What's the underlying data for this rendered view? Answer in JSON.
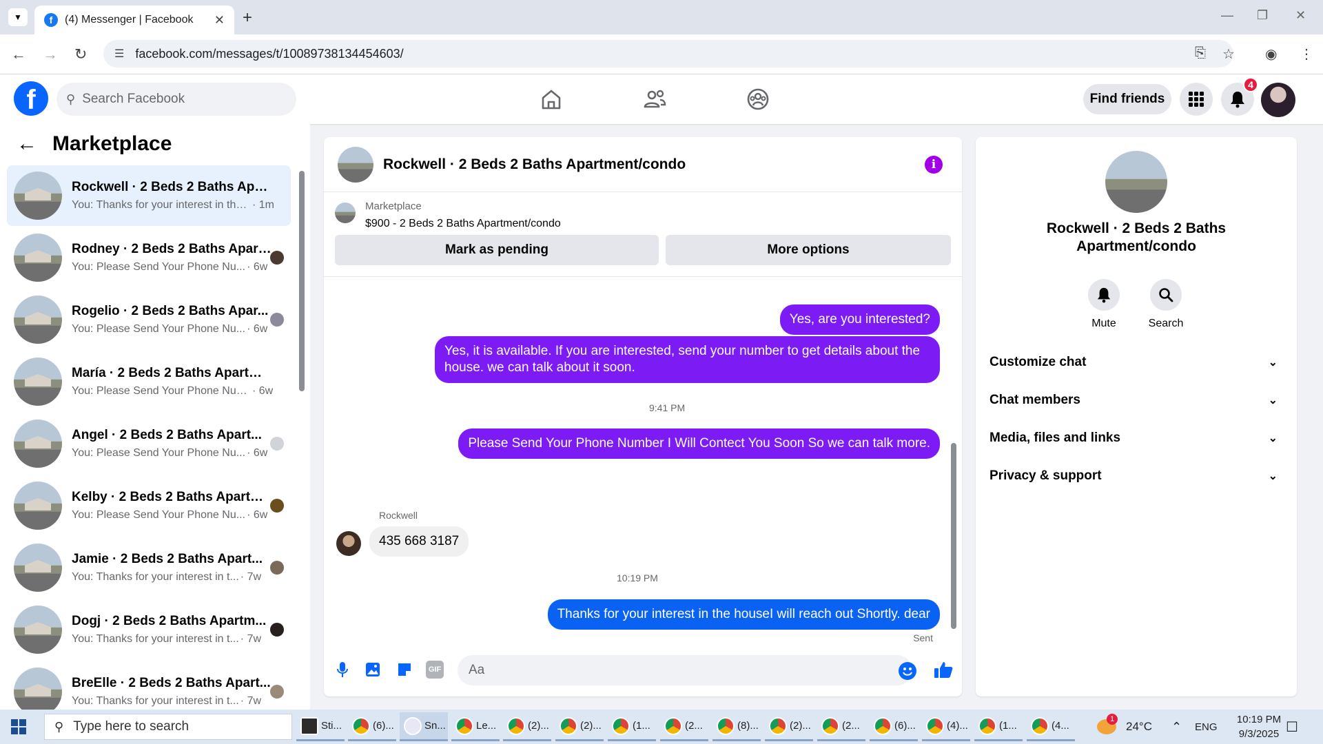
{
  "browser": {
    "tab_title": "(4) Messenger | Facebook",
    "url": "facebook.com/messages/t/10089738134454603/"
  },
  "fb": {
    "search_placeholder": "Search Facebook",
    "find_friends": "Find friends",
    "notification_count": "4"
  },
  "left": {
    "title": "Marketplace",
    "conversations": [
      {
        "name": "Rockwell · 2 Beds 2 Baths Apart...",
        "snippet": "You: Thanks for your interest in the...",
        "time": "· 1m"
      },
      {
        "name": "Rodney · 2 Beds 2 Baths Apart...",
        "snippet": "You: Please Send Your Phone Nu...",
        "time": "· 6w"
      },
      {
        "name": "Rogelio · 2 Beds 2 Baths Apar...",
        "snippet": "You: Please Send Your Phone Nu...",
        "time": "· 6w"
      },
      {
        "name": "María · 2 Beds 2 Baths Apartme...",
        "snippet": "You: Please Send Your Phone Num...",
        "time": "· 6w"
      },
      {
        "name": "Angel · 2 Beds 2 Baths Apart...",
        "snippet": "You: Please Send Your Phone Nu...",
        "time": "· 6w"
      },
      {
        "name": "Kelby · 2 Beds 2 Baths Apartm...",
        "snippet": "You: Please Send Your Phone Nu...",
        "time": "· 6w"
      },
      {
        "name": "Jamie · 2 Beds 2 Baths Apart...",
        "snippet": "You: Thanks for your interest in t...",
        "time": "· 7w"
      },
      {
        "name": "Dogj · 2 Beds 2 Baths Apartm...",
        "snippet": "You: Thanks for your interest in t...",
        "time": "· 7w"
      },
      {
        "name": "BreElle · 2 Beds 2 Baths Apart...",
        "snippet": "You: Thanks for your interest in t...",
        "time": "· 7w"
      }
    ]
  },
  "chat": {
    "title": "Rockwell · 2 Beds 2 Baths Apartment/condo",
    "marketplace_label": "Marketplace",
    "listing": "$900 - 2 Beds 2 Baths Apartment/condo",
    "mark_pending": "Mark as pending",
    "more_options": "More options",
    "messages": {
      "m1": "Yes, are you interested?",
      "m2": "Yes, it is available. If you are interested, send your number to get details about the house. we can talk about it soon.",
      "ts1": "9:41 PM",
      "m3": "Please Send Your Phone Number I Will Contect You Soon So we can talk more.",
      "sender": "Rockwell",
      "m4": "435 668 3187",
      "ts2": "10:19 PM",
      "m5": "Thanks for your interest in the houseI will reach out Shortly. dear",
      "status": "Sent"
    },
    "composer_placeholder": "Aa"
  },
  "right": {
    "name": "Rockwell · 2 Beds 2 Baths Apartment/condo",
    "mute": "Mute",
    "search": "Search",
    "sections": [
      "Customize chat",
      "Chat members",
      "Media, files and links",
      "Privacy & support"
    ]
  },
  "taskbar": {
    "search_placeholder": "Type here to search",
    "apps": [
      "Sti...",
      "(6)...",
      "Sn...",
      "Le...",
      "(2)...",
      "(2)...",
      "(1...",
      "(2...",
      "(8)...",
      "(2)...",
      "(2...",
      "(6)...",
      "(4)...",
      "(1...",
      "(4..."
    ],
    "weather_badge": "1",
    "temperature": "24°C",
    "lang": "ENG",
    "time": "10:19 PM",
    "date": "9/3/2025"
  },
  "colors": {
    "fb_blue": "#0866ff",
    "purple_bubble": "#7d1bf5",
    "blue_bubble": "#0a62f2"
  }
}
